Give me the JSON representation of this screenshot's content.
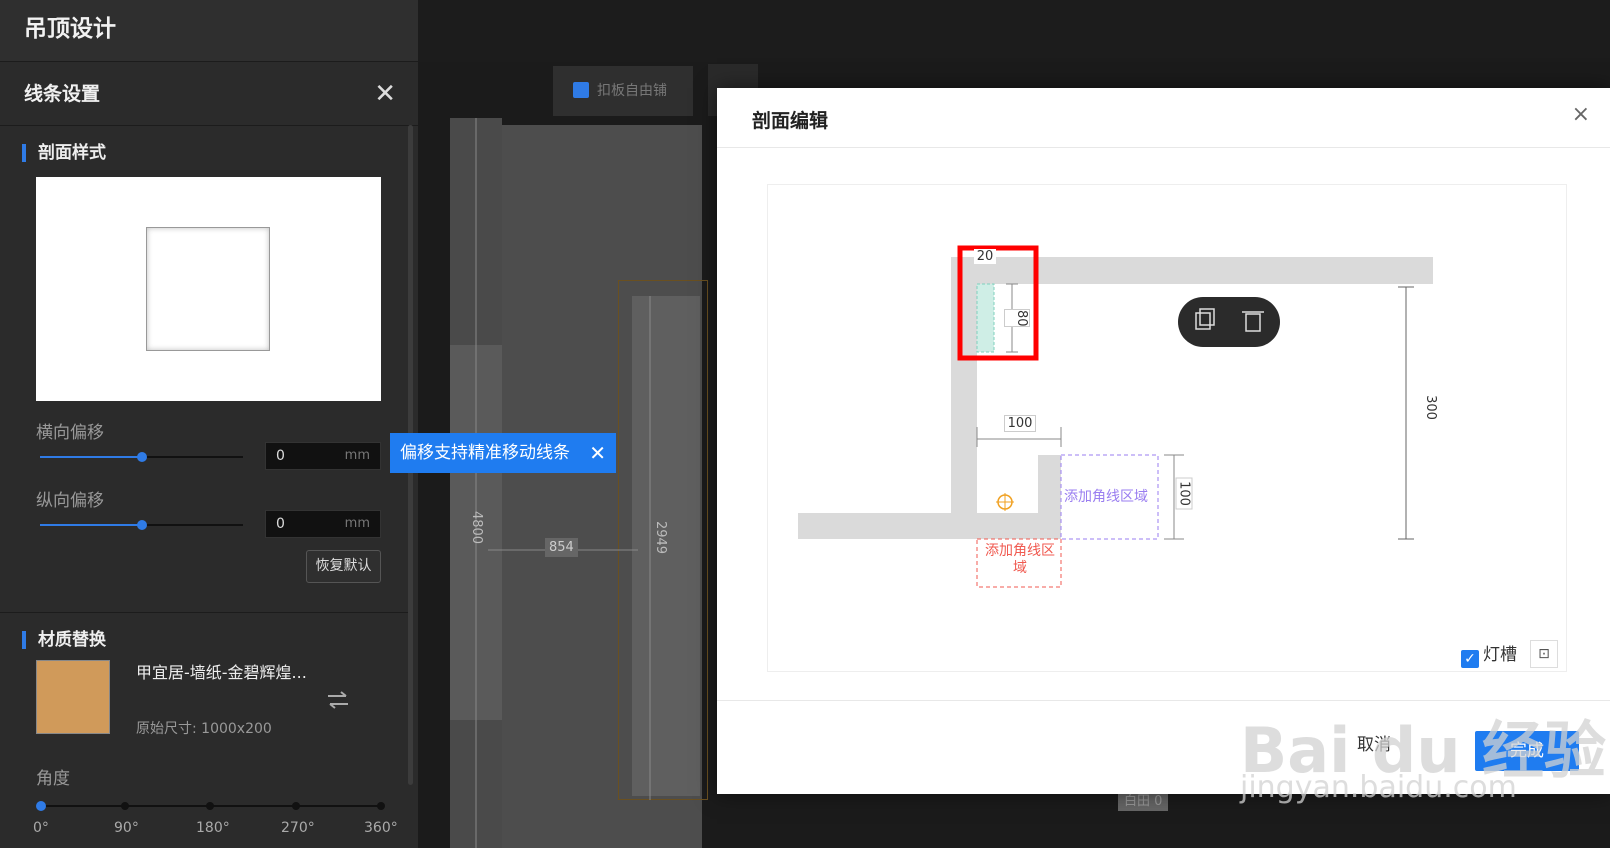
{
  "app": {
    "title": "吊顶设计"
  },
  "panel": {
    "title": "线条设置",
    "section_profile": "剖面样式",
    "h_offset": {
      "label": "横向偏移",
      "value": "0",
      "unit": "mm",
      "slider_fraction": 0.5
    },
    "v_offset": {
      "label": "纵向偏移",
      "value": "0",
      "unit": "mm",
      "slider_fraction": 0.5
    },
    "reset_label": "恢复默认",
    "section_material": "材质替换",
    "material": {
      "name": "甲宜居-墙纸-金碧辉煌...",
      "size": "原始尺寸: 1000x200",
      "color": "#d09a5a"
    },
    "angle": {
      "label": "角度",
      "ticks": [
        "0°",
        "90°",
        "180°",
        "270°",
        "360°"
      ],
      "value": "0°"
    }
  },
  "toolbar": {
    "free_tile_label": "扣板自由铺"
  },
  "canvas": {
    "dim_4800": "4800",
    "dim_854": "854",
    "dim_2949": "2949",
    "bottom_label": "白田 0"
  },
  "tooltip": {
    "text": "偏移支持精准移动线条",
    "close": "✕"
  },
  "modal": {
    "title": "剖面编辑",
    "close": "×",
    "dims": {
      "d20": "20",
      "d80": "80",
      "d300": "300",
      "d100a": "100",
      "d100b": "100"
    },
    "add_corner_purple": "添加角线区域",
    "add_corner_red_1": "添加角线区",
    "add_corner_red_2": "域",
    "light_slot_label": "灯槽",
    "light_slot_checked": true,
    "cancel_label": "取消",
    "done_label": "完成"
  },
  "watermark": {
    "line1": "Bai du 经验",
    "line2": "jingyan.baidu.com"
  },
  "colors": {
    "accent": "#1f7cf0",
    "highlight": "#ff0000",
    "purple": "#9a7ef0",
    "red_dashed": "#f05a50"
  }
}
